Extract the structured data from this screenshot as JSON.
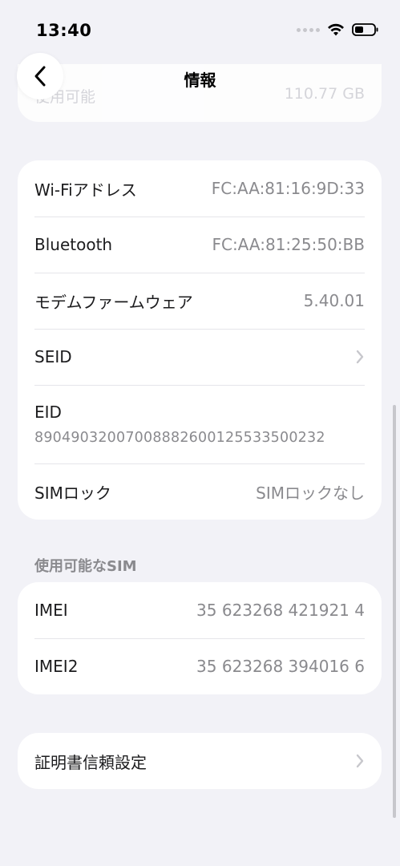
{
  "status_bar": {
    "time": "13:40",
    "signal_icon": "cellular-signal-icon",
    "wifi_icon": "wifi-icon",
    "battery_icon": "battery-icon"
  },
  "nav": {
    "title": "情報",
    "back_icon": "chevron-left-icon"
  },
  "faded_row": {
    "label": "使用可能",
    "value": "110.77 GB"
  },
  "network_group": {
    "wifi_label": "Wi-Fiアドレス",
    "wifi_value": "FC:AA:81:16:9D:33",
    "bluetooth_label": "Bluetooth",
    "bluetooth_value": "FC:AA:81:25:50:BB",
    "modem_label": "モデムファームウェア",
    "modem_value": "5.40.01",
    "seid_label": "SEID",
    "eid_label": "EID",
    "eid_value": "89049032007008882600125533500232",
    "simlock_label": "SIMロック",
    "simlock_value": "SIMロックなし"
  },
  "sim_section": {
    "header": "使用可能なSIM",
    "imei_label": "IMEI",
    "imei_value": "35 623268 421921 4",
    "imei2_label": "IMEI2",
    "imei2_value": "35 623268 394016 6"
  },
  "certificate_group": {
    "label": "証明書信頼設定"
  },
  "colors": {
    "background": "#f2f2f7",
    "card": "#ffffff",
    "secondary_text": "#8a8a8e",
    "chevron": "#c7c7cc"
  }
}
